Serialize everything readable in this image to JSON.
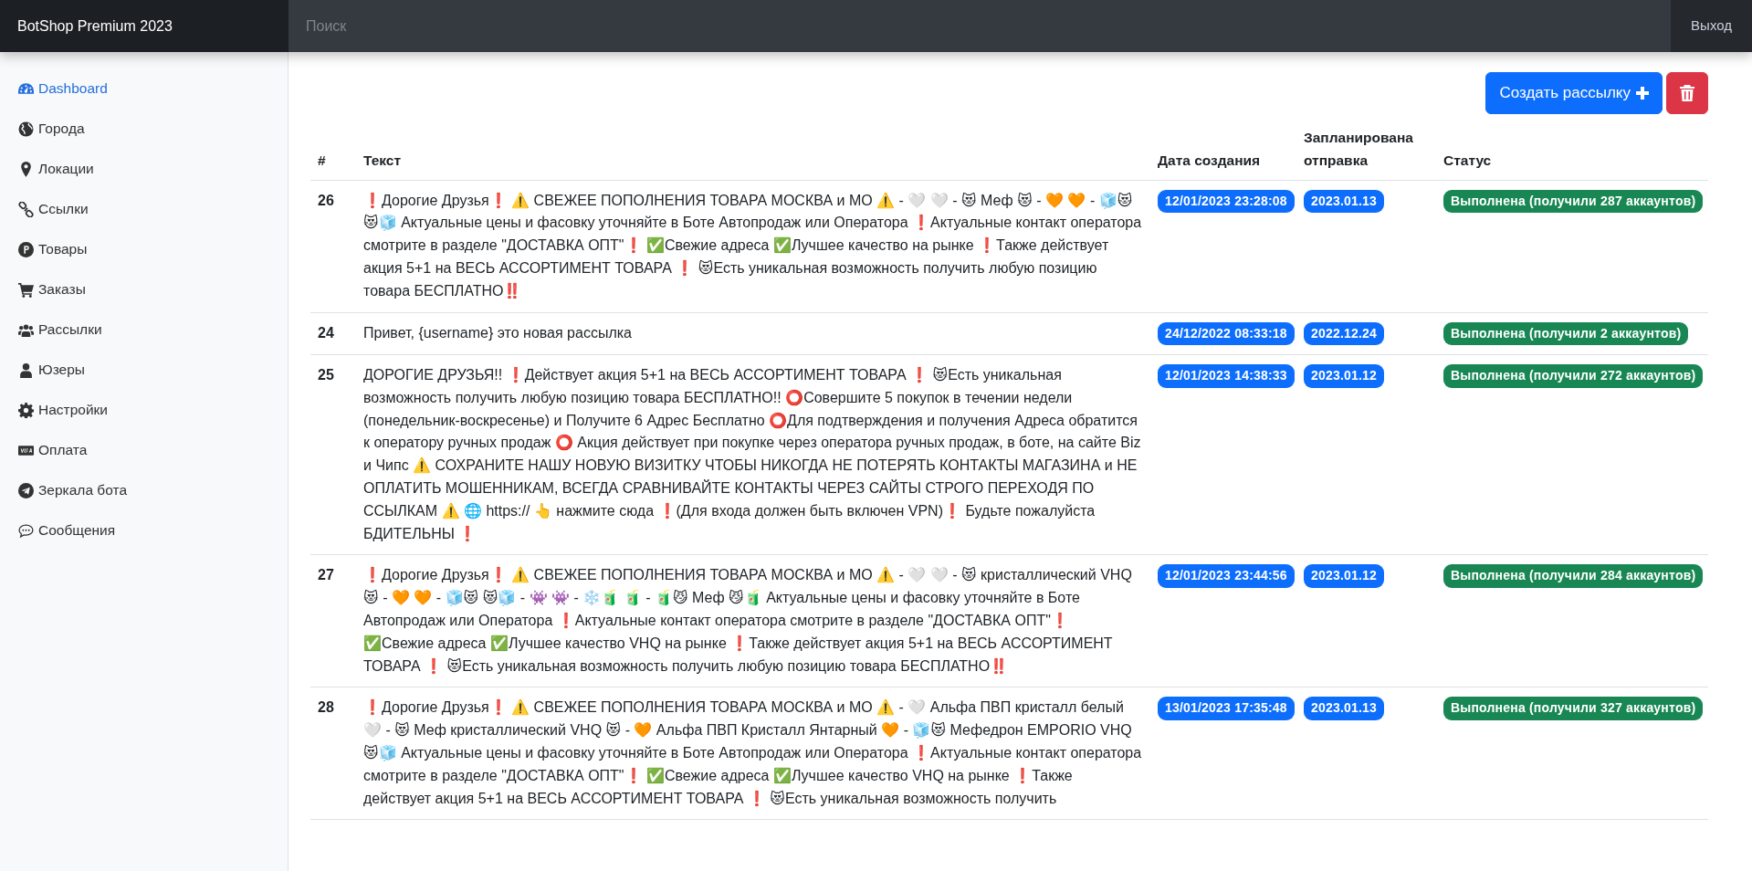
{
  "navbar": {
    "brand": "BotShop Premium 2023",
    "search": {
      "placeholder": "Поиск"
    },
    "logout": "Выход"
  },
  "sidebar": {
    "items": [
      {
        "label": "Dashboard",
        "kind": "gauge",
        "selected": true
      },
      {
        "label": "Города",
        "kind": "globe",
        "selected": false
      },
      {
        "label": "Локации",
        "kind": "pin",
        "selected": false
      },
      {
        "label": "Ссылки",
        "kind": "link",
        "selected": false
      },
      {
        "label": "Товары",
        "kind": "ruble",
        "selected": false
      },
      {
        "label": "Заказы",
        "kind": "cart",
        "selected": false
      },
      {
        "label": "Рассылки",
        "kind": "users",
        "selected": false
      },
      {
        "label": "Юзеры",
        "kind": "user",
        "selected": false
      },
      {
        "label": "Настройки",
        "kind": "gear",
        "selected": false
      },
      {
        "label": "Оплата",
        "kind": "card",
        "selected": false
      },
      {
        "label": "Зеркала бота",
        "kind": "plane",
        "selected": false
      },
      {
        "label": "Сообщения",
        "kind": "chat",
        "selected": false
      }
    ]
  },
  "toolbar": {
    "create_button": "Создать рассылку"
  },
  "table": {
    "columns": [
      "#",
      "Текст",
      "Дата создания",
      "Запланирована отправка",
      "Статус"
    ],
    "rows": [
      {
        "id": "26",
        "text": "❗Дорогие Друзья❗ ⚠️ СВЕЖЕЕ ПОПОЛНЕНИЯ ТОВАРА МОСКВА и МО ⚠️ - 🤍 🤍 - 😻 Меф 😻 - 🧡 🧡 - 🧊😻 😻🧊 Актуальные цены и фасовку уточняйте в Боте Автопродаж или Оператора ❗Актуальные контакт оператора смотрите в разделе \"ДОСТАВКА ОПТ\"❗ ✅Свежие адреса ✅Лучшее качество на рынке ❗Также действует акция 5+1 на ВЕСЬ АССОРТИМЕНТ ТОВАРА ❗ 😻Есть уникальная возможность получить любую позицию товара БЕСПЛАТНО‼️",
        "created": "12/01/2023 23:28:08",
        "scheduled": "2023.01.13",
        "status": "Выполнена (получили 287 аккаунтов)"
      },
      {
        "id": "24",
        "text": "Привет, {username} это новая рассылка",
        "created": "24/12/2022 08:33:18",
        "scheduled": "2022.12.24",
        "status": "Выполнена (получили 2 аккаунтов)"
      },
      {
        "id": "25",
        "text": "ДОРОГИЕ ДРУЗЬЯ!! ❗Действует акция 5+1 на ВЕСЬ АССОРТИМЕНТ ТОВАРА ❗ 😻Есть уникальная возможность получить любую позицию товара БЕСПЛАТНО!! ⭕Совершите 5 покупок в течении недели (понедельник-воскресенье) и Получите 6 Адрес Бесплатно ⭕Для подтверждения и получения Адреса обратится к оператору ручных продаж ⭕ Акция действует при покупке через оператора ручных продаж, в боте, на сайте Biz и Чипс ⚠️ СОХРАНИТЕ НАШУ НОВУЮ ВИЗИТКУ ЧТОБЫ НИКОГДА НЕ ПОТЕРЯТЬ КОНТАКТЫ МАГАЗИНА и НЕ ОПЛАТИТЬ МОШЕННИКАМ, ВСЕГДА СРАВНИВАЙТЕ КОНТАКТЫ ЧЕРЕЗ САЙТЫ СТРОГО ПЕРЕХОДЯ ПО ССЫЛКАМ ⚠️ 🌐 https:// 👆 нажмите сюда ❗(Для входа должен быть включен VPN)❗ Будьте пожалуйста БДИТЕЛЬНЫ ❗",
        "created": "12/01/2023 14:38:33",
        "scheduled": "2023.01.12",
        "status": "Выполнена (получили 272 аккаунтов)"
      },
      {
        "id": "27",
        "text": "❗Дорогие Друзья❗ ⚠️ СВЕЖЕЕ ПОПОЛНЕНИЯ ТОВАРА МОСКВА и МО ⚠️ - 🤍 🤍 - 😻 кристаллический VHQ 😻 - 🧡 🧡 - 🧊😻 😻🧊 - 👾 👾 - ❄️🧃 🧃 - 🧃😼 Меф 😼🧃 Актуальные цены и фасовку уточняйте в Боте Автопродаж или Оператора ❗Актуальные контакт оператора смотрите в разделе \"ДОСТАВКА ОПТ\"❗ ✅Свежие адреса ✅Лучшее качество VHQ на рынке ❗Также действует акция 5+1 на ВЕСЬ АССОРТИМЕНТ ТОВАРА ❗ 😻Есть уникальная возможность получить любую позицию товара БЕСПЛАТНО‼️",
        "created": "12/01/2023 23:44:56",
        "scheduled": "2023.01.12",
        "status": "Выполнена (получили 284 аккаунтов)"
      },
      {
        "id": "28",
        "text": "❗Дорогие Друзья❗ ⚠️ СВЕЖЕЕ ПОПОЛНЕНИЯ ТОВАРА МОСКВА и МО ⚠️ - 🤍 Альфа ПВП кристалл белый 🤍 - 😻 Меф кристаллический VHQ 😻 - 🧡 Альфа ПВП Кристалл Янтарный 🧡 - 🧊😻 Мефедрон EMPORIO VHQ 😻🧊 Актуальные цены и фасовку уточняйте в Боте Автопродаж или Оператора ❗Актуальные контакт оператора смотрите в разделе \"ДОСТАВКА ОПТ\"❗ ✅Свежие адреса ✅Лучшее качество VHQ на рынке ❗Также действует акция 5+1 на ВЕСЬ АССОРТИМЕНТ ТОВАРА ❗ 😻Есть уникальная возможность получить",
        "created": "13/01/2023 17:35:48",
        "scheduled": "2023.01.13",
        "status": "Выполнена (получили 327 аккаунтов)"
      }
    ]
  }
}
